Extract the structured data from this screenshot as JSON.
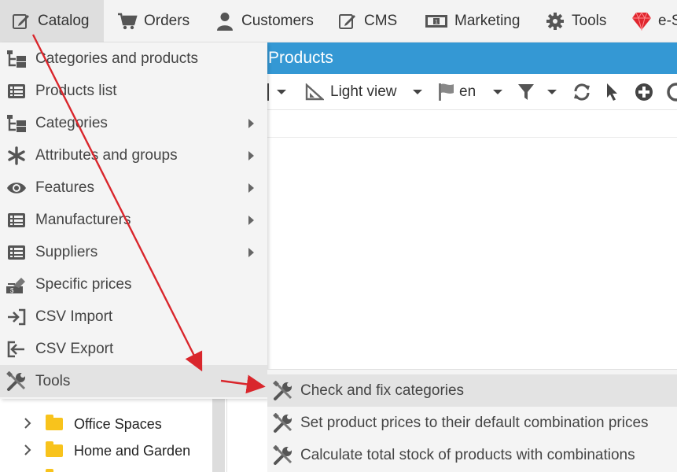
{
  "topnav": {
    "items": [
      {
        "label": "Catalog",
        "icon": "edit-icon"
      },
      {
        "label": "Orders",
        "icon": "cart-icon"
      },
      {
        "label": "Customers",
        "icon": "user-icon"
      },
      {
        "label": "CMS",
        "icon": "edit-icon"
      },
      {
        "label": "Marketing",
        "icon": "banknote-icon"
      },
      {
        "label": "Tools",
        "icon": "gear-icon"
      },
      {
        "label": "e-S",
        "icon": "ruby-gem-icon"
      }
    ]
  },
  "header": {
    "title": "Products"
  },
  "toolbar": {
    "view_label": "Light view",
    "lang_label": "en"
  },
  "menu": {
    "items": [
      {
        "label": "Categories and products",
        "icon": "tree-icon",
        "submenu": false
      },
      {
        "label": "Products list",
        "icon": "list-icon",
        "submenu": false
      },
      {
        "label": "Categories",
        "icon": "tree-icon",
        "submenu": true
      },
      {
        "label": "Attributes and groups",
        "icon": "asterisk-icon",
        "submenu": true
      },
      {
        "label": "Features",
        "icon": "eye-icon",
        "submenu": true
      },
      {
        "label": "Manufacturers",
        "icon": "list-icon",
        "submenu": true
      },
      {
        "label": "Suppliers",
        "icon": "list-icon",
        "submenu": true
      },
      {
        "label": "Specific prices",
        "icon": "price-tag-icon",
        "submenu": false
      },
      {
        "label": "CSV Import",
        "icon": "import-icon",
        "submenu": false
      },
      {
        "label": "CSV Export",
        "icon": "export-icon",
        "submenu": false
      },
      {
        "label": "Tools",
        "icon": "wrench-icon",
        "submenu": false
      }
    ]
  },
  "submenu": {
    "items": [
      {
        "label": "Check and fix categories"
      },
      {
        "label": "Set product prices to their default combination prices"
      },
      {
        "label": "Calculate total stock of products with combinations"
      }
    ]
  },
  "tree": {
    "items": [
      {
        "label": "Office Spaces"
      },
      {
        "label": "Home and Garden"
      }
    ]
  },
  "colors": {
    "header_bg": "#3498d4",
    "annotation_arrow": "#d9262c",
    "ruby": "#e0262e",
    "folder": "#f8c31c"
  }
}
